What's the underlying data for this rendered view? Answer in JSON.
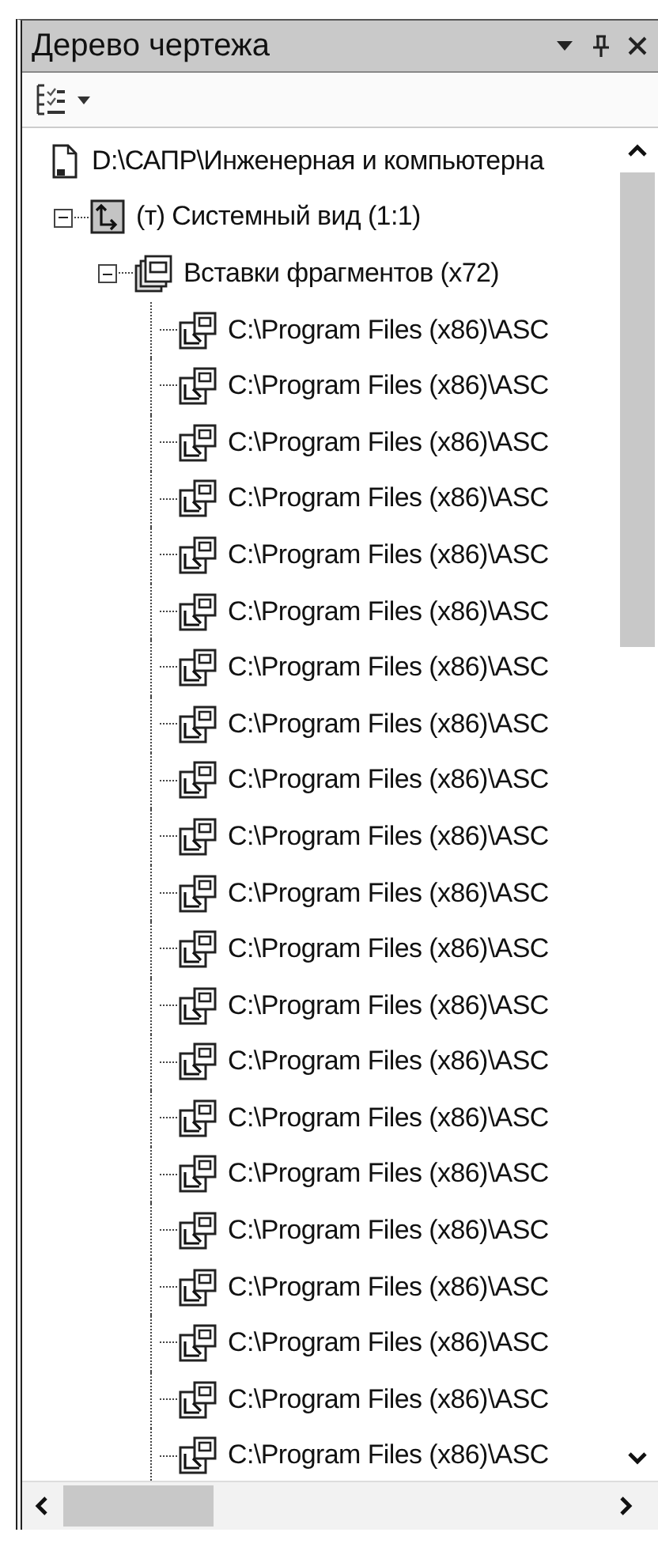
{
  "panel": {
    "title": "Дерево чертежа"
  },
  "tree": [
    {
      "label": "D:\\САПР\\Инженерная и компьютерна",
      "kind": "document",
      "children": [
        {
          "label": "(т) Системный вид (1:1)",
          "kind": "view",
          "expanded": true,
          "children": [
            {
              "label": "Вставки фрагментов (x72)",
              "kind": "group",
              "expanded": true,
              "children": [
                {
                  "label": "C:\\Program Files (x86)\\ASC",
                  "kind": "fragment"
                },
                {
                  "label": "C:\\Program Files (x86)\\ASC",
                  "kind": "fragment"
                },
                {
                  "label": "C:\\Program Files (x86)\\ASC",
                  "kind": "fragment"
                },
                {
                  "label": "C:\\Program Files (x86)\\ASC",
                  "kind": "fragment"
                },
                {
                  "label": "C:\\Program Files (x86)\\ASC",
                  "kind": "fragment"
                },
                {
                  "label": "C:\\Program Files (x86)\\ASC",
                  "kind": "fragment"
                },
                {
                  "label": "C:\\Program Files (x86)\\ASC",
                  "kind": "fragment"
                },
                {
                  "label": "C:\\Program Files (x86)\\ASC",
                  "kind": "fragment"
                },
                {
                  "label": "C:\\Program Files (x86)\\ASC",
                  "kind": "fragment"
                },
                {
                  "label": "C:\\Program Files (x86)\\ASC",
                  "kind": "fragment"
                },
                {
                  "label": "C:\\Program Files (x86)\\ASC",
                  "kind": "fragment"
                },
                {
                  "label": "C:\\Program Files (x86)\\ASC",
                  "kind": "fragment"
                },
                {
                  "label": "C:\\Program Files (x86)\\ASC",
                  "kind": "fragment"
                },
                {
                  "label": "C:\\Program Files (x86)\\ASC",
                  "kind": "fragment"
                },
                {
                  "label": "C:\\Program Files (x86)\\ASC",
                  "kind": "fragment"
                },
                {
                  "label": "C:\\Program Files (x86)\\ASC",
                  "kind": "fragment"
                },
                {
                  "label": "C:\\Program Files (x86)\\ASC",
                  "kind": "fragment"
                },
                {
                  "label": "C:\\Program Files (x86)\\ASC",
                  "kind": "fragment"
                },
                {
                  "label": "C:\\Program Files (x86)\\ASC",
                  "kind": "fragment"
                },
                {
                  "label": "C:\\Program Files (x86)\\ASC",
                  "kind": "fragment"
                },
                {
                  "label": "C:\\Program Files (x86)\\ASC",
                  "kind": "fragment"
                }
              ]
            }
          ]
        }
      ]
    }
  ]
}
